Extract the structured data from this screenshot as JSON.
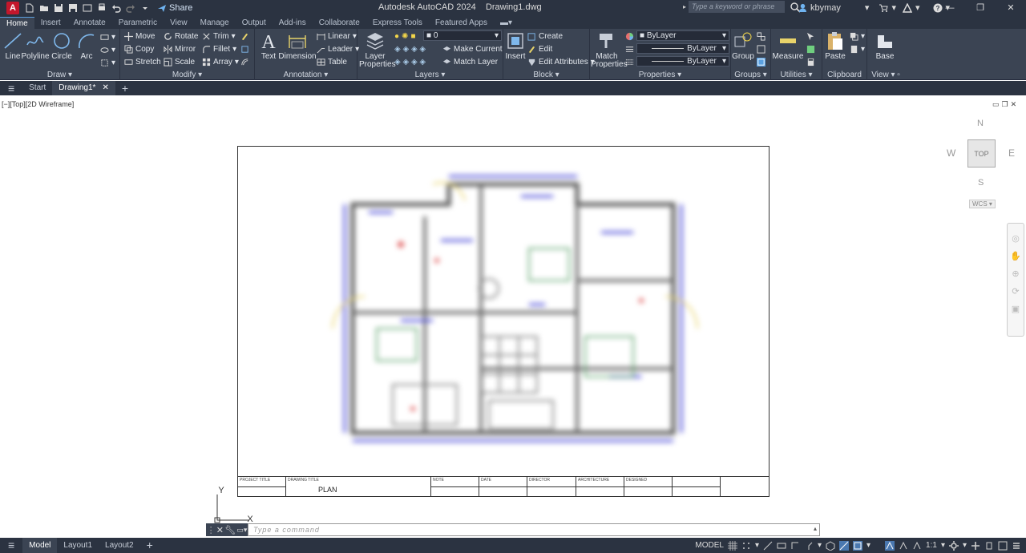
{
  "app": {
    "title": "Autodesk AutoCAD 2024",
    "document": "Drawing1.dwg",
    "share_label": "Share",
    "search_placeholder": "Type a keyword or phrase",
    "username": "kbymay"
  },
  "ribbon_tabs": [
    "Home",
    "Insert",
    "Annotate",
    "Parametric",
    "View",
    "Manage",
    "Output",
    "Add-ins",
    "Collaborate",
    "Express Tools",
    "Featured Apps"
  ],
  "panels": {
    "draw": {
      "title": "Draw",
      "line": "Line",
      "polyline": "Polyline",
      "circle": "Circle",
      "arc": "Arc"
    },
    "modify": {
      "title": "Modify",
      "move": "Move",
      "rotate": "Rotate",
      "trim": "Trim",
      "copy": "Copy",
      "mirror": "Mirror",
      "fillet": "Fillet",
      "stretch": "Stretch",
      "scale": "Scale",
      "array": "Array"
    },
    "annotation": {
      "title": "Annotation",
      "text": "Text",
      "dimension": "Dimension",
      "linear": "Linear",
      "leader": "Leader",
      "table": "Table"
    },
    "layers": {
      "title": "Layers",
      "properties": "Layer Properties",
      "current_layer": "0",
      "make_current": "Make Current",
      "match_layer": "Match Layer"
    },
    "block": {
      "title": "Block",
      "insert": "Insert",
      "create": "Create",
      "edit": "Edit",
      "edit_attributes": "Edit Attributes"
    },
    "properties": {
      "title": "Properties",
      "match": "Match Properties",
      "color": "ByLayer",
      "linetype": "ByLayer",
      "lineweight": "ByLayer"
    },
    "groups": {
      "title": "Groups",
      "group": "Group"
    },
    "utilities": {
      "title": "Utilities",
      "measure": "Measure"
    },
    "clipboard": {
      "title": "Clipboard",
      "paste": "Paste"
    },
    "view": {
      "title": "View",
      "base": "Base"
    }
  },
  "doc_tabs": {
    "start": "Start",
    "drawing": "Drawing1*"
  },
  "viewport": {
    "label": "[−][Top][2D Wireframe]",
    "viewcube": {
      "n": "N",
      "s": "S",
      "e": "E",
      "w": "W",
      "face": "TOP",
      "wcs": "WCS"
    }
  },
  "titleblock": {
    "project_title": "PROJECT TITLE",
    "drawing_title": "DRAWING TITLE",
    "drawing_value": "PLAN",
    "note": "NOTE",
    "date": "DATE",
    "director": "DIRECTOR",
    "architecture": "ARCHITECTURE",
    "designed": "DESIGNED"
  },
  "ucs": {
    "x": "X",
    "y": "Y"
  },
  "command": {
    "placeholder": "Type a command"
  },
  "status": {
    "layouts": [
      "Model",
      "Layout1",
      "Layout2"
    ],
    "mode": "MODEL",
    "scale": "1:1"
  },
  "colors": {
    "accent": "#5aa0e0",
    "titlebar": "#2b3341",
    "ribbon": "#3b4453"
  }
}
